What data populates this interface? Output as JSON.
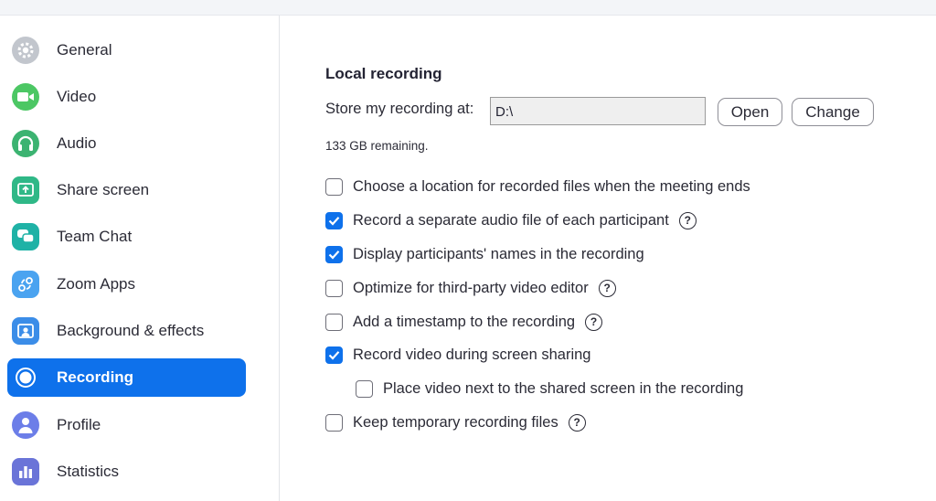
{
  "sidebar": {
    "items": [
      {
        "label": "General",
        "icon": "gear-icon",
        "color": "#b8bcc4"
      },
      {
        "label": "Video",
        "icon": "video-camera-icon",
        "color": "#4cc764"
      },
      {
        "label": "Audio",
        "icon": "headphones-icon",
        "color": "#3cb371"
      },
      {
        "label": "Share screen",
        "icon": "share-screen-icon",
        "color": "#2fb887"
      },
      {
        "label": "Team Chat",
        "icon": "chat-bubble-icon",
        "color": "#1fb2a6"
      },
      {
        "label": "Zoom Apps",
        "icon": "zoom-apps-icon",
        "color": "#4aa3f0"
      },
      {
        "label": "Background & effects",
        "icon": "background-person-icon",
        "color": "#3b8de8"
      },
      {
        "label": "Recording",
        "icon": "record-icon",
        "color": "#ffffff",
        "active": true
      },
      {
        "label": "Profile",
        "icon": "person-icon",
        "color": "#6c7ee8"
      },
      {
        "label": "Statistics",
        "icon": "bar-chart-icon",
        "color": "#6a74d8"
      }
    ]
  },
  "recording": {
    "section_title": "Local recording",
    "store_label": "Store my recording at:",
    "path_value": "D:\\",
    "open_label": "Open",
    "change_label": "Change",
    "remaining": "133 GB remaining.",
    "options": [
      {
        "label": "Choose a location for recorded files when the meeting ends",
        "checked": false,
        "help": false
      },
      {
        "label": "Record a separate audio file of each participant",
        "checked": true,
        "help": true
      },
      {
        "label": "Display participants' names in the recording",
        "checked": true,
        "help": false
      },
      {
        "label": "Optimize for third-party video editor",
        "checked": false,
        "help": true
      },
      {
        "label": "Add a timestamp to the recording",
        "checked": false,
        "help": true
      },
      {
        "label": "Record video during screen sharing",
        "checked": true,
        "help": false
      },
      {
        "label": "Place video next to the shared screen in the recording",
        "checked": false,
        "help": false
      },
      {
        "label": "Keep temporary recording files",
        "checked": false,
        "help": true
      }
    ],
    "help_glyph": "?",
    "accent_color": "#0e71eb"
  }
}
